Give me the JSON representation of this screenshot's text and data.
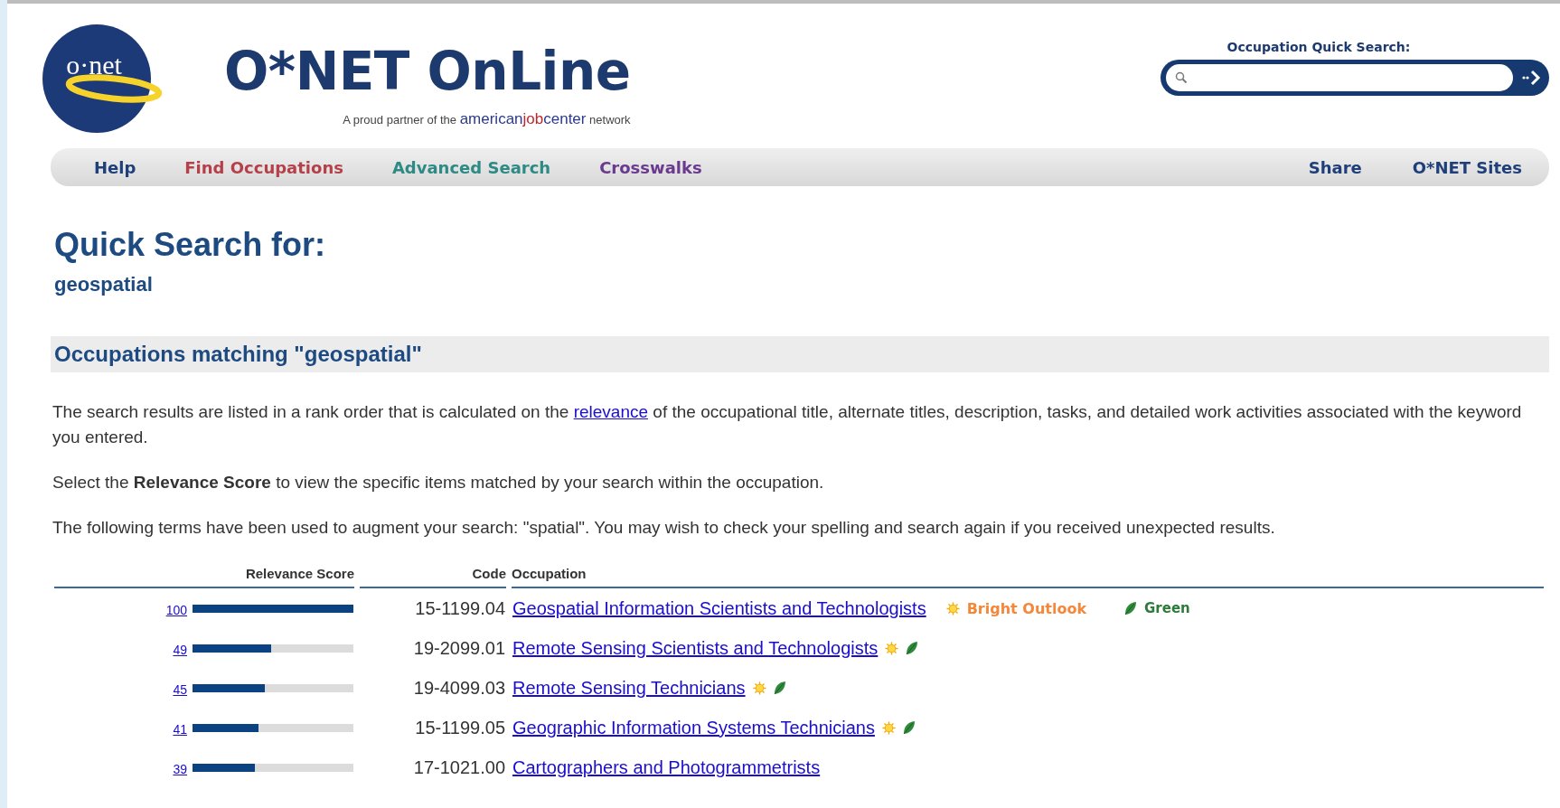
{
  "header": {
    "logo_text": "o·net",
    "site_title": "O*NET OnLine",
    "tagline": {
      "before": "A proud partner of the",
      "brand": [
        {
          "text": "american",
          "color": "#2b3a8f"
        },
        {
          "text": "job",
          "color": "#c0272d"
        },
        {
          "text": "center",
          "color": "#2b3a8f"
        }
      ],
      "after": "network"
    }
  },
  "quick_search": {
    "label": "Occupation Quick Search:"
  },
  "nav": {
    "left": [
      {
        "label": "Help",
        "color": "#1f3f7a"
      },
      {
        "label": "Find Occupations",
        "color": "#b5404a"
      },
      {
        "label": "Advanced Search",
        "color": "#2e8a84"
      },
      {
        "label": "Crosswalks",
        "color": "#6a3a8e"
      }
    ],
    "right": [
      {
        "label": "Share",
        "color": "#1f3f7a"
      },
      {
        "label": "O*NET Sites",
        "color": "#1f3f7a"
      }
    ]
  },
  "page_title": "Quick Search for:",
  "query": "geospatial",
  "section_title": "Occupations matching \"geospatial\"",
  "intro": {
    "before": "The search results are listed in a rank order that is calculated on the",
    "link": "relevance",
    "after": "of the occupational title, alternate titles, description, tasks, and detailed work activities associated with the keyword you entered."
  },
  "paragraphs": [
    "Select the **Relevance Score** to view the specific items matched by your search within the occupation.",
    "The following terms have been used to augment your search: \"spatial\". You may wish to check your spelling and search again if you received unexpected results."
  ],
  "table": {
    "columns": [
      "Relevance Score",
      "Code",
      "Occupation"
    ],
    "rows": [
      {
        "score": "100",
        "level": 1.0,
        "code": "15-1199.04",
        "occupation": "Geospatial Information Scientists and Technologists",
        "bright_outlook": true,
        "bright_label": "Bright Outlook",
        "green": true,
        "green_label": "Green"
      },
      {
        "score": "49",
        "level": 0.49,
        "code": "19-2099.01",
        "occupation": "Remote Sensing Scientists and Technologists",
        "bright_outlook": true,
        "green": true
      },
      {
        "score": "45",
        "level": 0.45,
        "code": "19-4099.03",
        "occupation": "Remote Sensing Technicians",
        "bright_outlook": true,
        "green": true
      },
      {
        "score": "41",
        "level": 0.41,
        "code": "15-1199.05",
        "occupation": "Geographic Information Systems Technicians",
        "bright_outlook": true,
        "green": true
      },
      {
        "score": "39",
        "level": 0.39,
        "code": "17-1021.00",
        "occupation": "Cartographers and Photogrammetrists",
        "bright_outlook": false,
        "green": false
      }
    ]
  }
}
